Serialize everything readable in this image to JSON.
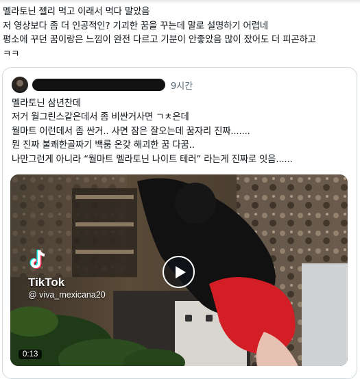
{
  "post": {
    "lines": [
      "멜라토닌 젤리 먹고 이래서 먹다 말았음",
      "저 영상보다 좀 더 인공적인? 기괴한 꿈을 꾸는데 말로 설명하기 어렵네",
      "평소에 꾸던 꿈이랑은 느낌이 완전 다르고 기분이 안좋았음 많이 잤어도 더 피곤하고",
      "ㅋㅋ"
    ]
  },
  "quoted": {
    "time": "9시간",
    "lines": [
      "멜라토닌 삼년찬데",
      "저거 월그린스같은데서 좀 비싼거사면 ㄱㅊ은데",
      "월마트 이런데서 좀 싼거.. 사면 잠은 잘오는데 꿈자리 진짜.......",
      "뭔 진짜 불쾌한골짜기 백룸 온갖 해괴한 꿈 다꿈..",
      "나만그런게 아니라 “월마트 멜라토닌 나이트 테러” 라는게 진짜로 잇음......"
    ],
    "video": {
      "watermark_brand": "TikTok",
      "watermark_handle": "@ viva_mexicana20",
      "duration": "0:13"
    }
  },
  "colors": {
    "text": "#0f1419",
    "secondary_text": "#536471",
    "border": "#cfd9de"
  }
}
